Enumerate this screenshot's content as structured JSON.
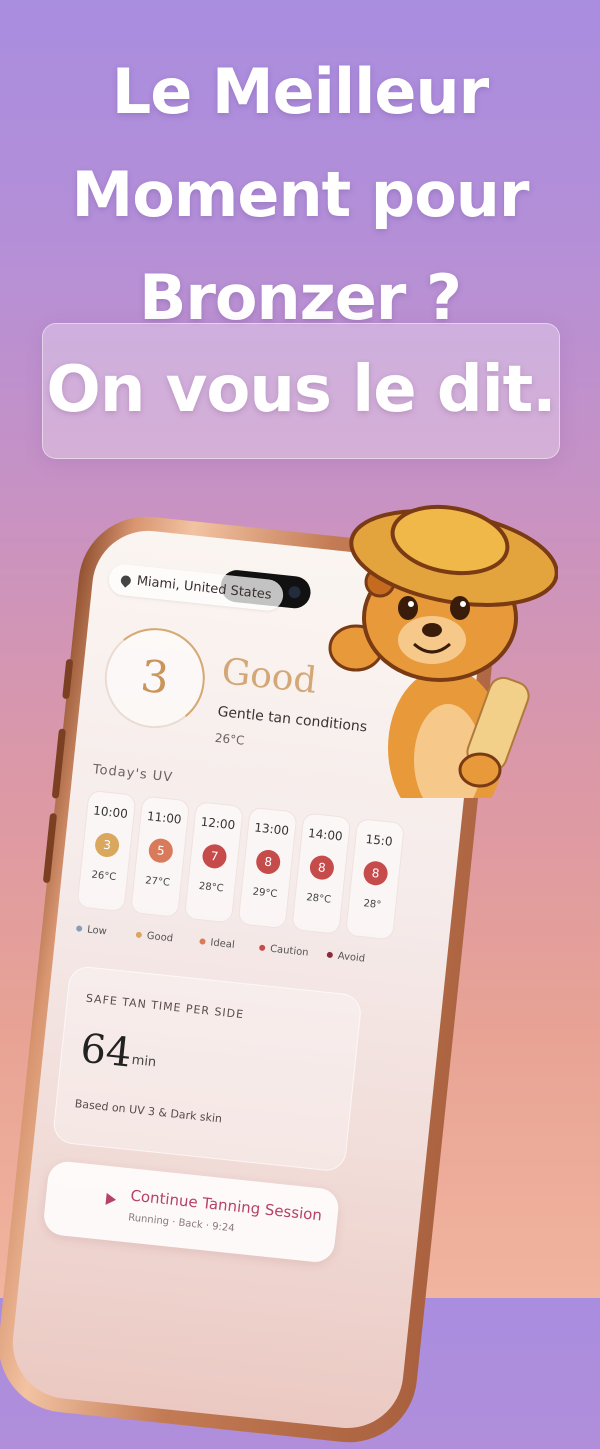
{
  "headline": {
    "line1": "Le Meilleur",
    "line2": "Moment pour",
    "line3": "Bronzer ?",
    "tagline": "On vous le dit."
  },
  "app": {
    "location": "Miami, United States",
    "uv_index": "3",
    "status": "Good",
    "status_sub": "Gentle tan conditions",
    "temperature": "26°C",
    "today_label": "Today's UV",
    "hours": [
      {
        "time": "10:00",
        "uv": "3",
        "temp": "26°C",
        "color": "#d9a75e"
      },
      {
        "time": "11:00",
        "uv": "5",
        "temp": "27°C",
        "color": "#d97a5a"
      },
      {
        "time": "12:00",
        "uv": "7",
        "temp": "28°C",
        "color": "#c64b4b"
      },
      {
        "time": "13:00",
        "uv": "8",
        "temp": "29°C",
        "color": "#c64b4b"
      },
      {
        "time": "14:00",
        "uv": "8",
        "temp": "28°C",
        "color": "#c64b4b"
      },
      {
        "time": "15:0",
        "uv": "8",
        "temp": "28°",
        "color": "#c64b4b"
      }
    ],
    "legend": [
      {
        "label": "Low",
        "color": "#8a9bb5"
      },
      {
        "label": "Good",
        "color": "#d9a75e"
      },
      {
        "label": "Ideal",
        "color": "#d97a5a"
      },
      {
        "label": "Caution",
        "color": "#c64b4b"
      },
      {
        "label": "Avoid",
        "color": "#8a2a3a"
      }
    ],
    "safe_title": "SAFE TAN TIME PER SIDE",
    "safe_value": "64",
    "safe_unit": "min",
    "safe_note": "Based on UV 3 & Dark skin",
    "session_title": "Continue Tanning Session",
    "session_sub": "Running · Back · 9:24"
  },
  "colors": {
    "accent": "#b5426a",
    "gold": "#d4a777"
  }
}
